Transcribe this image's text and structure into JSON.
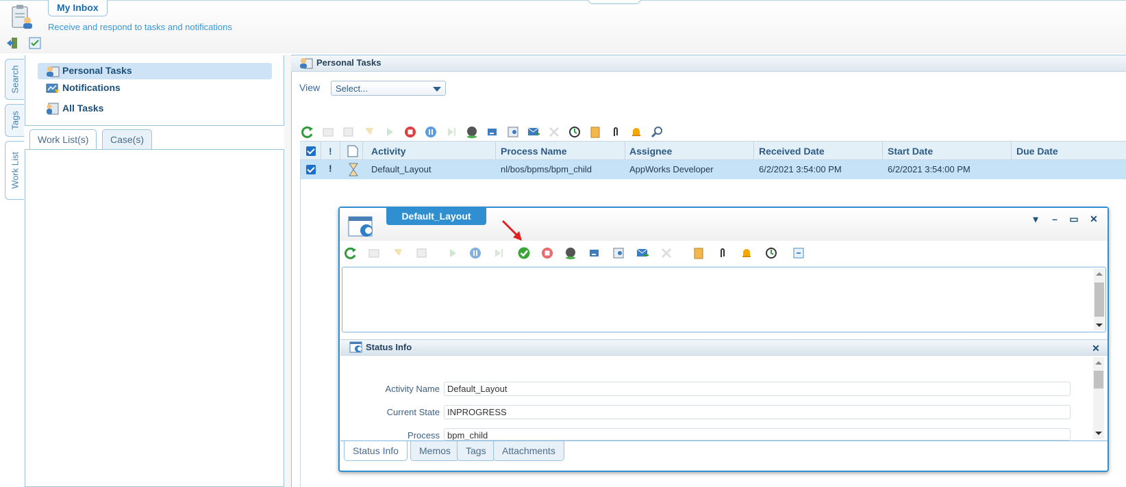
{
  "header": {
    "title": "My Inbox",
    "subtitle": "Receive and respond to tasks and notifications"
  },
  "left_tabs": [
    "Search",
    "Tags",
    "Work List"
  ],
  "nav": {
    "items": [
      {
        "label": "Personal Tasks",
        "icon": "personal-tasks-icon"
      },
      {
        "label": "Notifications",
        "icon": "notifications-icon"
      },
      {
        "label": "All Tasks",
        "icon": "all-tasks-icon"
      }
    ]
  },
  "worklist_tabs": [
    "Work List(s)",
    "Case(s)"
  ],
  "panel": {
    "title": "Personal Tasks",
    "view_label": "View",
    "view_select": "Select..."
  },
  "grid": {
    "columns": [
      "Activity",
      "Process Name",
      "Assignee",
      "Received Date",
      "Start Date",
      "Due Date"
    ],
    "rows": [
      {
        "activity": "Default_Layout",
        "process_name": "nl/bos/bpms/bpm_child",
        "assignee": "AppWorks Developer",
        "received_date": "6/2/2021 3:54:00 PM",
        "start_date": "6/2/2021 3:54:00 PM",
        "due_date": ""
      }
    ]
  },
  "popup": {
    "title": "Default_Layout",
    "status_title": "Status Info",
    "fields": [
      {
        "label": "Activity Name",
        "value": "Default_Layout"
      },
      {
        "label": "Current State",
        "value": "INPROGRESS"
      },
      {
        "label": "Process",
        "value": "bpm_child"
      }
    ],
    "tabs": [
      "Status Info",
      "Memos",
      "Tags",
      "Attachments"
    ]
  },
  "colors": {
    "accent": "#2f8fd0",
    "selected_row": "#c6e2f7",
    "nav_active": "#cfe3f7",
    "annotation_arrow": "#e02020"
  }
}
